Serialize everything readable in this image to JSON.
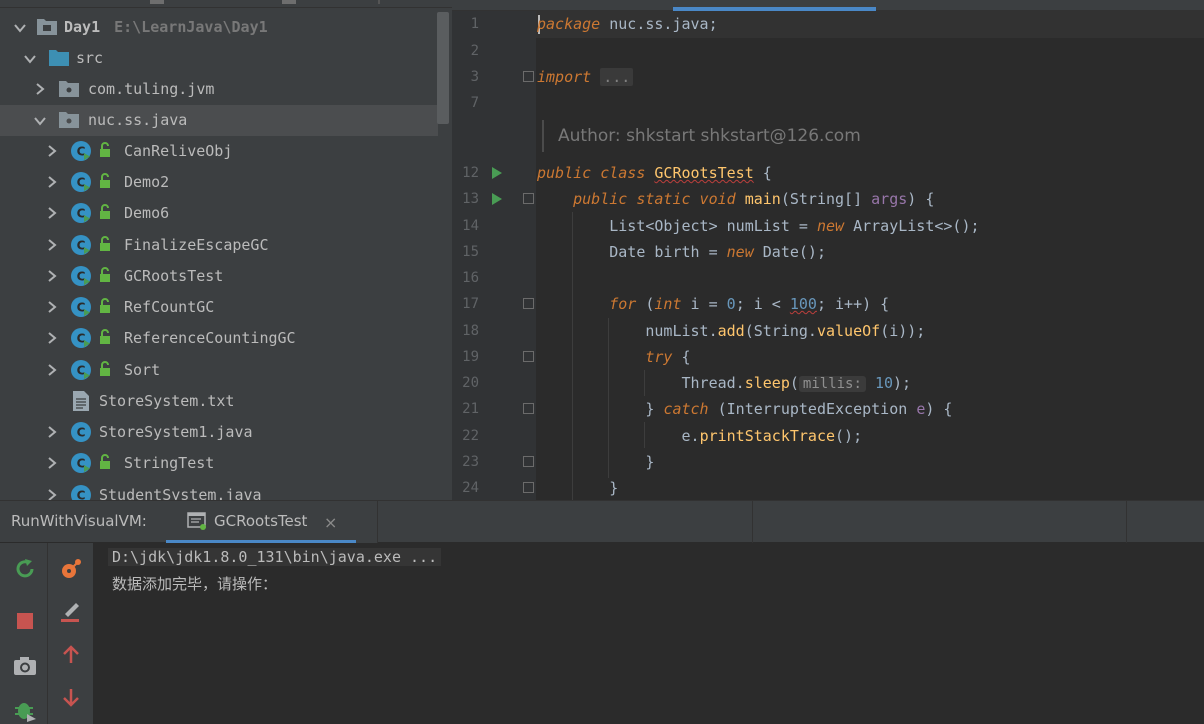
{
  "project": {
    "root_name": "Day1",
    "root_path": "E:\\LearnJava\\Day1",
    "items": [
      {
        "label": "src",
        "kind": "folder"
      },
      {
        "label": "com.tuling.jvm",
        "kind": "package"
      },
      {
        "label": "nuc.ss.java",
        "kind": "package"
      },
      {
        "label": "CanReliveObj",
        "kind": "class"
      },
      {
        "label": "Demo2",
        "kind": "class"
      },
      {
        "label": "Demo6",
        "kind": "class"
      },
      {
        "label": "FinalizeEscapeGC",
        "kind": "class"
      },
      {
        "label": "GCRootsTest",
        "kind": "class"
      },
      {
        "label": "RefCountGC",
        "kind": "class"
      },
      {
        "label": "ReferenceCountingGC",
        "kind": "class"
      },
      {
        "label": "Sort",
        "kind": "class"
      },
      {
        "label": "StoreSystem.txt",
        "kind": "text-file"
      },
      {
        "label": "StoreSystem1.java",
        "kind": "java-file"
      },
      {
        "label": "StringTest",
        "kind": "class"
      },
      {
        "label": "StudentSystem.java",
        "kind": "java-file"
      }
    ]
  },
  "editor": {
    "line_numbers": [
      "1",
      "2",
      "3",
      "7",
      "12",
      "13",
      "14",
      "15",
      "16",
      "17",
      "18",
      "19",
      "20",
      "21",
      "22",
      "23",
      "24"
    ],
    "author_note": "Author: shkstart shkstart@126.com",
    "code": {
      "l1_kw": "package",
      "l1_rest": " nuc.ss.java;",
      "l3_kw": "import",
      "l3_fold": "...",
      "l12_kw": "public class",
      "l12_name": "GCRootsTest",
      "l12_rest": " {",
      "l13_kw": "public static void",
      "l13_fn": "main",
      "l13_a": "(String[] ",
      "l13_param": "args",
      "l13_b": ") {",
      "l14_a": "List<Object> numList = ",
      "l14_kw": "new",
      "l14_b": " ArrayList<>();",
      "l15_a": "Date birth = ",
      "l15_kw": "new",
      "l15_b": " Date();",
      "l17_kw": "for",
      "l17_a": " (",
      "l17_kw2": "int",
      "l17_b": " i = ",
      "l17_n0": "0",
      "l17_c": "; i < ",
      "l17_n1": "100",
      "l17_d": "; i++) {",
      "l18_a": "numList.",
      "l18_fn": "add",
      "l18_b": "(String.",
      "l18_fn2": "valueOf",
      "l18_c": "(i));",
      "l19_kw": "try",
      "l19_b": " {",
      "l20_a": "Thread.",
      "l20_fn": "sleep",
      "l20_b": "(",
      "l20_hint": "millis:",
      "l20_n": "10",
      "l20_c": ");",
      "l21_a": "} ",
      "l21_kw": "catch",
      "l21_b": " (InterruptedException ",
      "l21_param": "e",
      "l21_c": ") {",
      "l22_a": "e.",
      "l22_fn": "printStackTrace",
      "l22_b": "();",
      "l23": "}",
      "l24": "}"
    }
  },
  "run_panel": {
    "title": "RunWithVisualVM:",
    "tab_label": "GCRootsTest",
    "close_glyph": "×",
    "output": [
      "D:\\jdk\\jdk1.8.0_131\\bin\\java.exe ...",
      "数据添加完毕，请操作："
    ]
  },
  "colors": {
    "accent": "#4a88c7",
    "run_green": "#499c54",
    "stop_red": "#c75450",
    "class_icon": "#3592c4"
  }
}
